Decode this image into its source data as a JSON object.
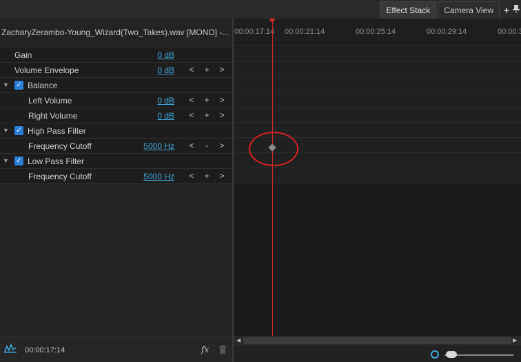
{
  "tabs": [
    {
      "label": "Effect Stack",
      "active": true
    },
    {
      "label": "Camera View",
      "active": false
    }
  ],
  "tab_icons": {
    "add": "+",
    "pin": "pin-icon"
  },
  "clip_title": "ZacharyZerambo-Young_Wizard(Two_Takes).wav  [MONO] -...",
  "properties": [
    {
      "name": "Gain",
      "value": "0 dB",
      "controls": [
        "",
        "",
        ""
      ]
    },
    {
      "name": "Volume Envelope",
      "value": "0 dB",
      "controls": [
        "<",
        "+",
        ">"
      ]
    },
    {
      "name": "Balance",
      "group": true,
      "checked": true
    },
    {
      "name": "Left Volume",
      "value": "0 dB",
      "controls": [
        "<",
        "+",
        ">"
      ]
    },
    {
      "name": "Right Volume",
      "value": "0 dB",
      "controls": [
        "<",
        "+",
        ">"
      ]
    },
    {
      "name": "High Pass Filter",
      "group": true,
      "checked": true
    },
    {
      "name": "Frequency Cutoff",
      "value": "5000 Hz",
      "controls": [
        "<",
        "-",
        ">"
      ]
    },
    {
      "name": "Low Pass Filter",
      "group": true,
      "checked": true
    },
    {
      "name": "Frequency Cutoff",
      "value": "5000 Hz",
      "controls": [
        "<",
        "+",
        ">"
      ]
    }
  ],
  "bottom": {
    "time": "00:00:17:14",
    "fx_label": "fx"
  },
  "ruler": {
    "labels": [
      "00:00:17:14",
      "00:00:21:14",
      "00:00:25:14",
      "00:00:29:14",
      "00:00:3"
    ]
  },
  "colors": {
    "accent": "#3fa6d9",
    "playhead": "#d12b2b",
    "highlight": "#d61f1f",
    "check": "#2b7fd8"
  }
}
